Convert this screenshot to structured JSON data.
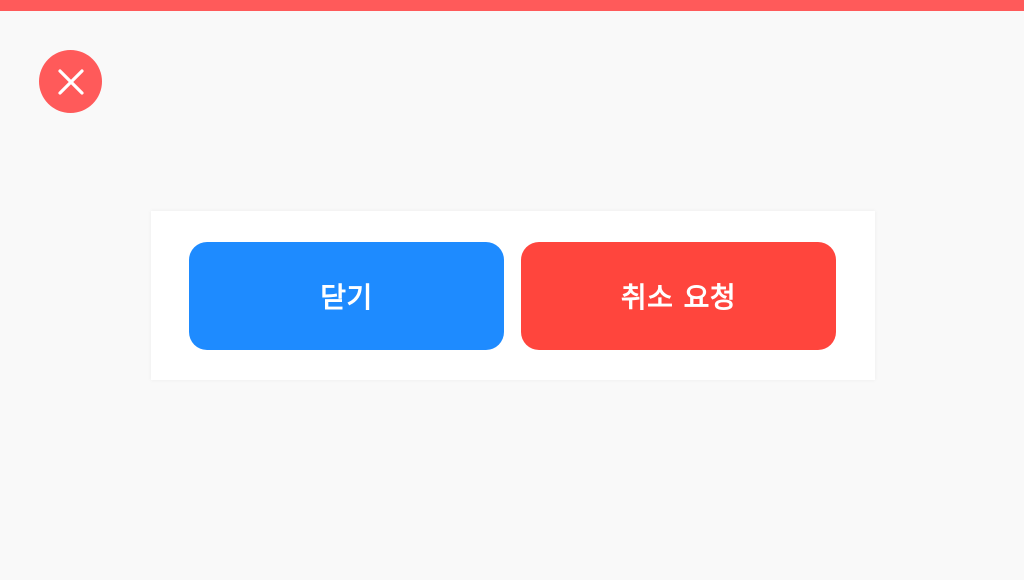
{
  "colors": {
    "top_bar": "#ff5a5a",
    "close_icon_bg": "#ff5a5a",
    "close_icon_stroke": "#ffffff",
    "close_button_bg": "#1e8bff",
    "cancel_request_button_bg": "#ff453d",
    "background": "#f9f9f9",
    "panel_bg": "#ffffff"
  },
  "header": {
    "close_icon": "close-icon"
  },
  "dialog": {
    "close_label": "닫기",
    "cancel_request_label": "취소 요청"
  }
}
